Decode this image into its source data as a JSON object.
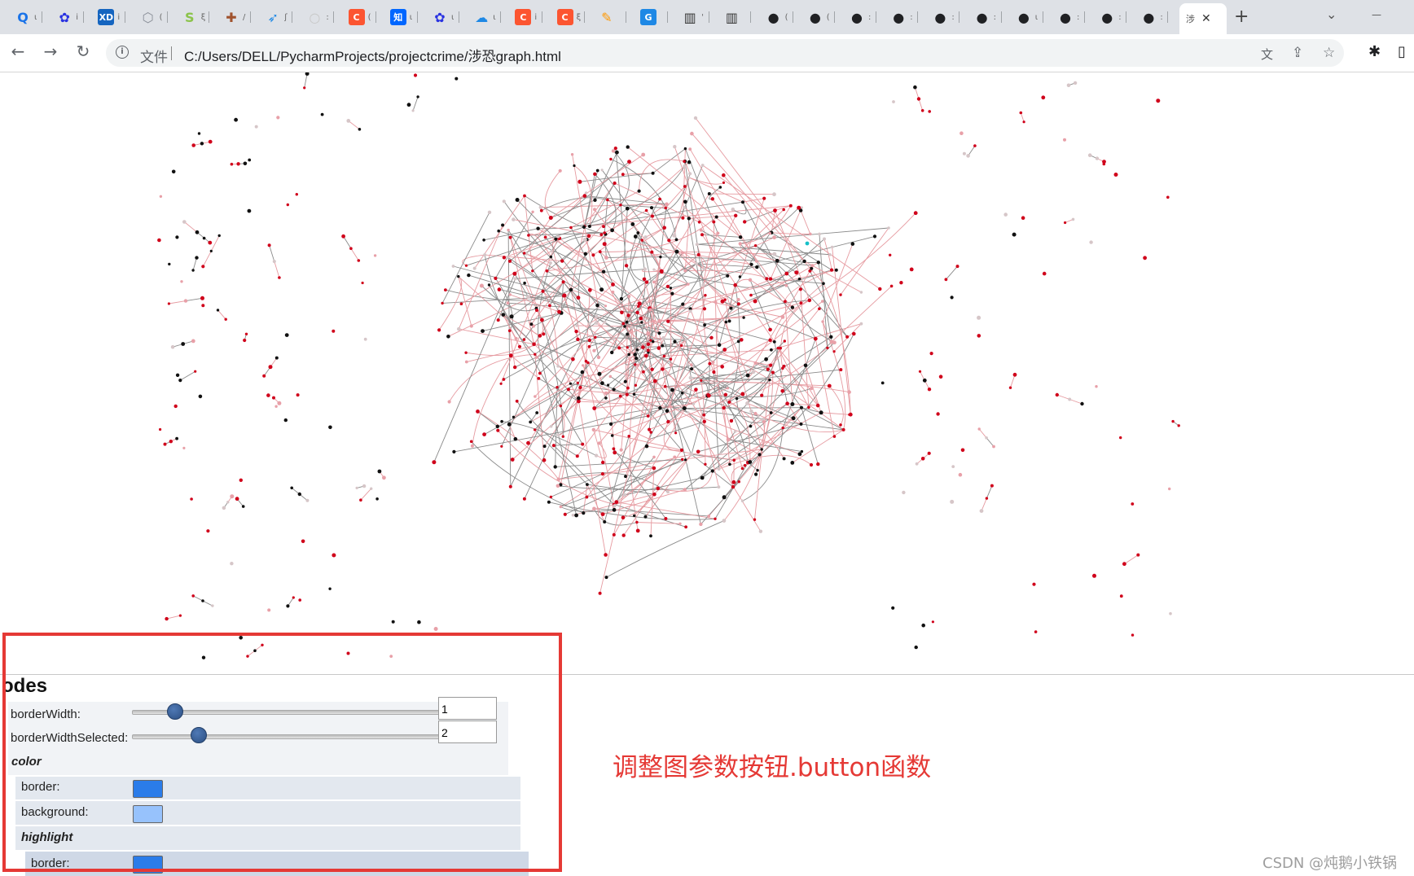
{
  "browser": {
    "tabs": [
      {
        "icon": "search-icon",
        "glyph": "Q",
        "color": "#1a73e8",
        "frag": "ι"
      },
      {
        "icon": "baidu-paw-icon",
        "glyph": "✿",
        "color": "#2932e1",
        "frag": "i"
      },
      {
        "icon": "xd-icon",
        "glyph": "XD",
        "color": "#1565c0",
        "frag": "i"
      },
      {
        "icon": "cube-icon",
        "glyph": "⬡",
        "color": "#8a8f98",
        "frag": "("
      },
      {
        "icon": "s-green-icon",
        "glyph": "S",
        "color": "#8bc34a",
        "frag": "ξ"
      },
      {
        "icon": "shield-cross-icon",
        "glyph": "✚",
        "color": "#a0522d",
        "frag": "/"
      },
      {
        "icon": "bird-icon",
        "glyph": "➶",
        "color": "#1e88e5",
        "frag": "ʃ"
      },
      {
        "icon": "circle-gray-icon",
        "glyph": "○",
        "color": "#c8c8c8",
        "frag": ":"
      },
      {
        "icon": "csdn-icon",
        "glyph": "C",
        "color": "#fc5531",
        "frag": "("
      },
      {
        "icon": "zhihu-icon",
        "glyph": "知",
        "color": "#0066ff",
        "frag": "ι"
      },
      {
        "icon": "baidu-paw-icon",
        "glyph": "✿",
        "color": "#2932e1",
        "frag": "ι"
      },
      {
        "icon": "cloud-icon",
        "glyph": "☁",
        "color": "#1e88e5",
        "frag": "ι"
      },
      {
        "icon": "csdn-icon",
        "glyph": "C",
        "color": "#fc5531",
        "frag": "i"
      },
      {
        "icon": "csdn-icon",
        "glyph": "C",
        "color": "#fc5531",
        "frag": "ξ"
      },
      {
        "icon": "feather-icon",
        "glyph": "✎",
        "color": "#ff9800",
        "frag": ""
      },
      {
        "icon": "translate-icon",
        "glyph": "G",
        "color": "#1e88e5",
        "frag": ""
      },
      {
        "icon": "book-icon",
        "glyph": "▥",
        "color": "#333333",
        "frag": "'"
      },
      {
        "icon": "book-icon",
        "glyph": "▥",
        "color": "#333333",
        "frag": ""
      },
      {
        "icon": "globe-icon",
        "glyph": "●",
        "color": "#202124",
        "frag": "("
      },
      {
        "icon": "globe-icon",
        "glyph": "●",
        "color": "#202124",
        "frag": "("
      },
      {
        "icon": "globe-icon",
        "glyph": "●",
        "color": "#202124",
        "frag": ":"
      },
      {
        "icon": "globe-icon",
        "glyph": "●",
        "color": "#202124",
        "frag": ":"
      },
      {
        "icon": "globe-icon",
        "glyph": "●",
        "color": "#202124",
        "frag": ":"
      },
      {
        "icon": "globe-icon",
        "glyph": "●",
        "color": "#202124",
        "frag": ":"
      },
      {
        "icon": "globe-icon",
        "glyph": "●",
        "color": "#202124",
        "frag": "ι"
      },
      {
        "icon": "globe-icon",
        "glyph": "●",
        "color": "#202124",
        "frag": ":"
      },
      {
        "icon": "globe-icon",
        "glyph": "●",
        "color": "#202124",
        "frag": ":"
      },
      {
        "icon": "globe-icon",
        "glyph": "●",
        "color": "#202124",
        "frag": ":"
      }
    ],
    "active_tab_label": "涉",
    "close_glyph": "✕",
    "new_tab_glyph": "+",
    "minimize_glyph": "—",
    "dropdown_glyph": "⌄",
    "back_glyph": "←",
    "forward_glyph": "→",
    "reload_glyph": "↻",
    "info_glyph": "i",
    "scheme_label": "文件",
    "url": "C:/Users/DELL/PycharmProjects/projectcrime/涉恐graph.html",
    "translate_glyph": "文",
    "share_glyph": "⇪",
    "bookmark_glyph": "☆",
    "extensions_glyph": "✱",
    "sidepanel_glyph": "▯"
  },
  "config_panel": {
    "heading": "odes",
    "border_width_label": "borderWidth:",
    "border_width_value": "1",
    "border_width_level": 0.12,
    "border_width_selected_label": "borderWidthSelected:",
    "border_width_selected_value": "2",
    "border_width_selected_level": 0.2,
    "color_label": "color",
    "border_label": "border:",
    "border_color": "#2b7ce9",
    "background_label": "background:",
    "background_color": "#97c2fc",
    "highlight_label": "highlight",
    "highlight_border_label": "border:",
    "highlight_border_color": "#2b7ce9"
  },
  "annotation": "调整图参数按钮.button函数",
  "watermark": "CSDN @炖鹅小铁锅",
  "graph_colors": {
    "node_red": "#d0021b",
    "node_black": "#111111",
    "node_pink": "#e8a0a8",
    "node_light": "#d6c6c8",
    "edge_gray": "#8a8a8a",
    "edge_pink": "#e69aa0",
    "highlight_cyan": "#16c0c8"
  }
}
